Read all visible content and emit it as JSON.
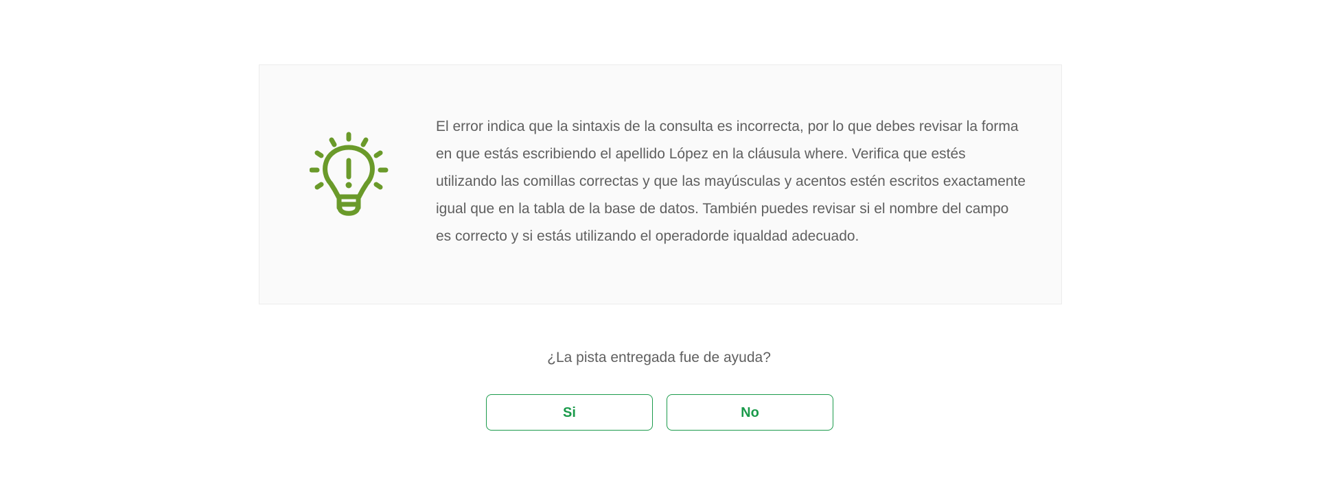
{
  "hint": {
    "icon": "lightbulb-exclamation-icon",
    "text": "El error indica que la sintaxis de la consulta es incorrecta, por lo que debes revisar la forma en que estás escribiendo el apellido López en la cláusula where. Verifica que estés utilizando las comillas correctas y que las mayúsculas y acentos estén escritos exactamente igual que en la tabla de la base de datos. También puedes revisar si el nombre del campo es correcto y si estás utilizando el operadorde iqualdad adecuado."
  },
  "feedback": {
    "question": "¿La pista entregada fue de ayuda?",
    "yes_label": "Si",
    "no_label": "No"
  },
  "colors": {
    "icon_green": "#6a9a2a",
    "button_green": "#1a9a4a",
    "text_gray": "#5f5f5f",
    "card_background": "#fafafa"
  }
}
